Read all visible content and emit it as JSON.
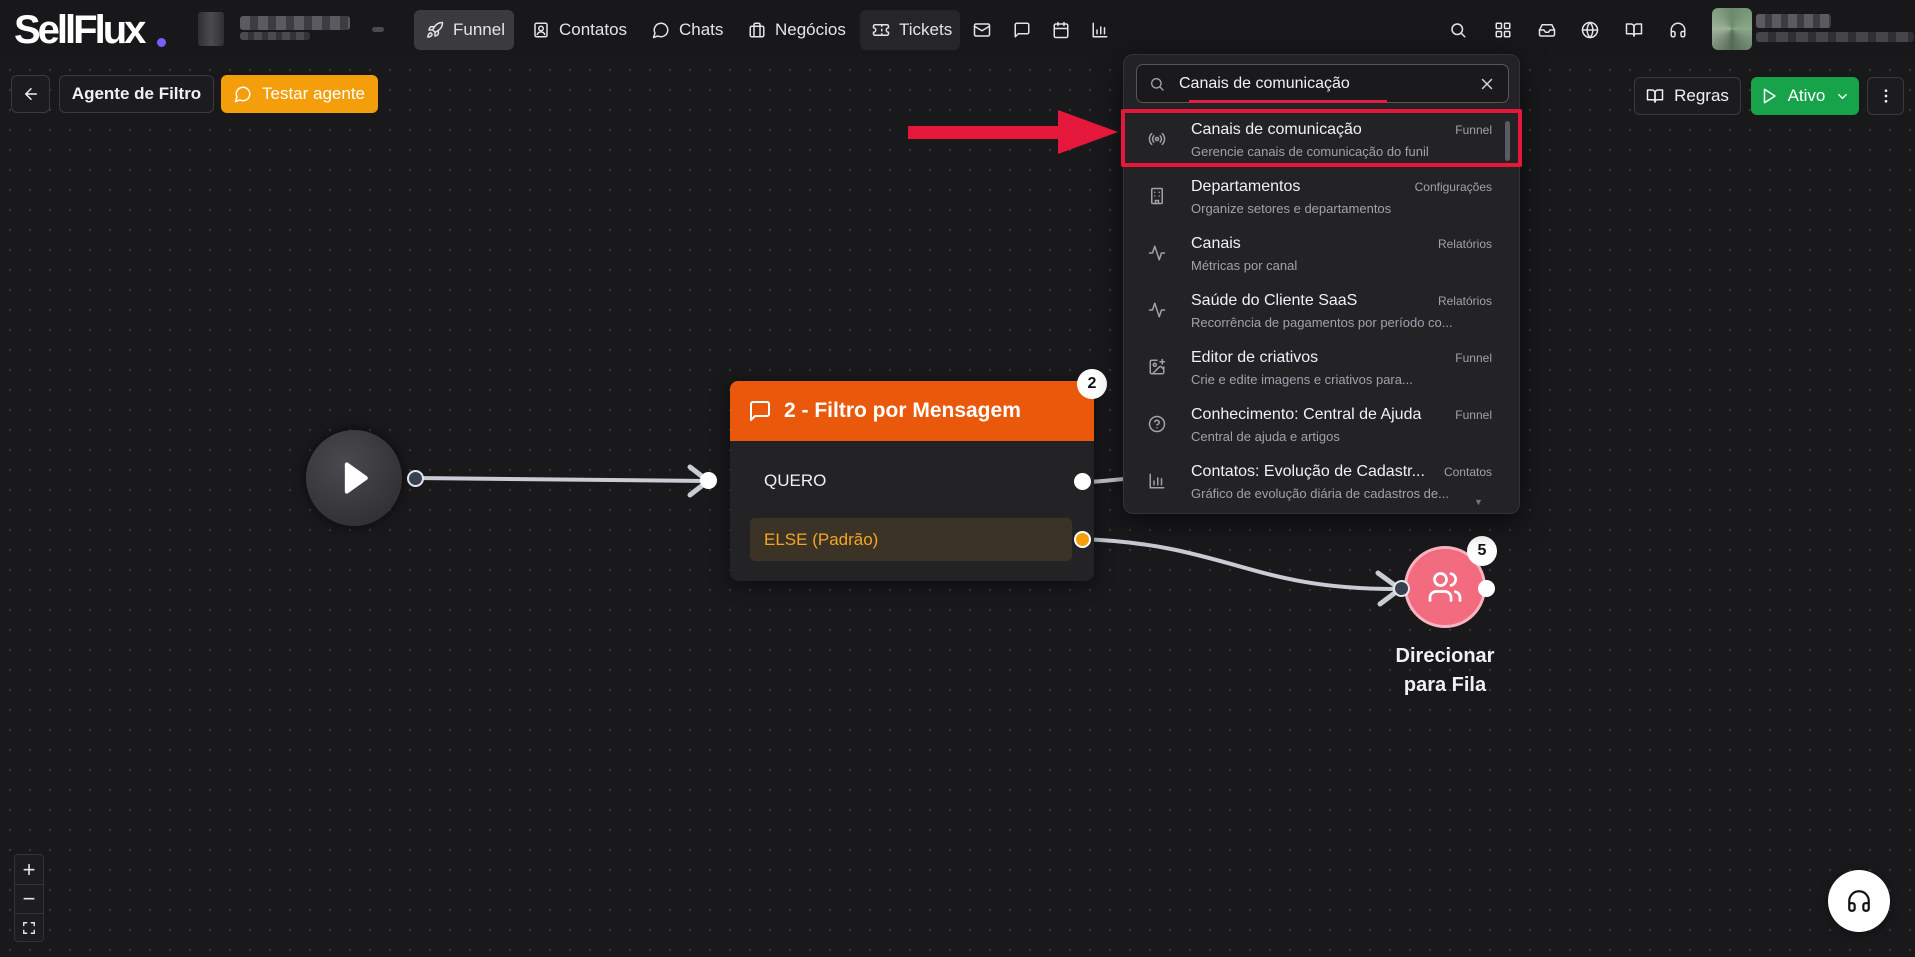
{
  "brand": {
    "logo_text": "SellFlux",
    "accent": "#7c5cff"
  },
  "nav": {
    "items": [
      {
        "label": "Funnel",
        "icon": "rocket-icon"
      },
      {
        "label": "Contatos",
        "icon": "contact-card-icon"
      },
      {
        "label": "Chats",
        "icon": "chat-bubble-icon"
      },
      {
        "label": "Negócios",
        "icon": "briefcase-icon"
      },
      {
        "label": "Tickets",
        "icon": "ticket-icon"
      }
    ],
    "extra_icons": [
      "mail-icon",
      "message-square-icon",
      "calendar-icon",
      "bar-chart-icon"
    ],
    "right_icons": [
      "search-icon",
      "apps-grid-icon",
      "inbox-icon",
      "globe-icon",
      "book-icon",
      "headset-icon"
    ]
  },
  "toolbar": {
    "agent_name": "Agente de Filtro",
    "test_label": "Testar agente",
    "rules_label": "Regras",
    "status_label": "Ativo",
    "test_color": "#f59e0b",
    "status_color": "#16a34a"
  },
  "flow": {
    "filter_node": {
      "title": "2 - Filtro por Mensagem",
      "badge": "2",
      "conditions": [
        "QUERO",
        "ELSE (Padrão)"
      ],
      "header_color": "#ea580c"
    },
    "queue_node": {
      "label": "Direcionar para Fila",
      "badge": "5",
      "color": "#f26b7f"
    }
  },
  "zoom": {
    "in": "+",
    "out": "−"
  },
  "search": {
    "value": "Canais de comunicação",
    "results": [
      {
        "title": "Canais de comunicação",
        "desc": "Gerencie canais de comunicação do funil",
        "category": "Funnel",
        "icon": "broadcast-icon"
      },
      {
        "title": "Departamentos",
        "desc": "Organize setores e departamentos",
        "category": "Configurações",
        "icon": "building-icon"
      },
      {
        "title": "Canais",
        "desc": "Métricas por canal",
        "category": "Relatórios",
        "icon": "activity-icon"
      },
      {
        "title": "Saúde do Cliente SaaS",
        "desc": "Recorrência de pagamentos por período co...",
        "category": "Relatórios",
        "icon": "activity-icon"
      },
      {
        "title": "Editor de criativos",
        "desc": "Crie e edite imagens e criativos para...",
        "category": "Funnel",
        "icon": "image-plus-icon"
      },
      {
        "title": "Conhecimento: Central de Ajuda",
        "desc": "Central de ajuda e artigos",
        "category": "Funnel",
        "icon": "help-circle-icon"
      },
      {
        "title": "Contatos: Evolução de Cadastr...",
        "desc": "Gráfico de evolução diária de cadastros de...",
        "category": "Contatos",
        "icon": "bar-chart-icon"
      }
    ],
    "highlight_color": "#e5173a"
  }
}
